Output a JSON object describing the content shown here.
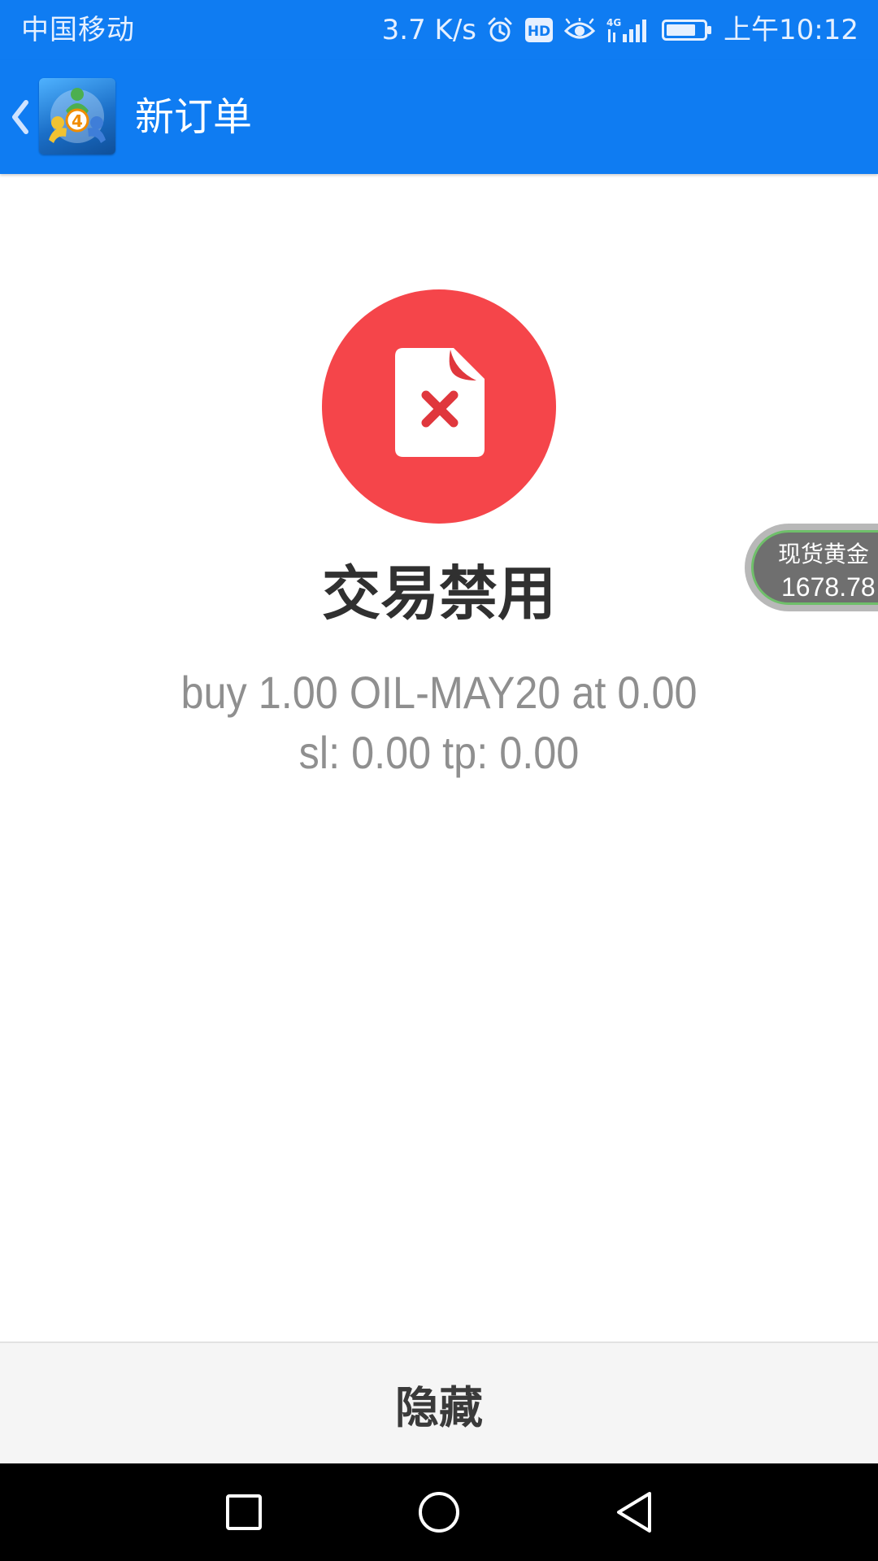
{
  "status_bar": {
    "carrier": "中国移动",
    "network_speed": "3.7 K/s",
    "hd_badge": "HD",
    "signal_type": "4G",
    "time": "上午10:12",
    "icons": [
      "alarm-icon",
      "hd-icon",
      "eye-icon",
      "signal-icon",
      "battery-icon"
    ]
  },
  "app_bar": {
    "title": "新订单",
    "logo_badge": "4",
    "icons": [
      "back-chevron-icon",
      "metatrader-logo"
    ]
  },
  "result": {
    "icon": "document-error-icon",
    "headline": "交易禁用",
    "order_line_1": "buy 1.00 OIL-MAY20 at 0.00",
    "order_line_2": "sl: 0.00 tp: 0.00"
  },
  "ticker": {
    "name": "现货黄金",
    "price": "1678.78"
  },
  "actions": {
    "hide_label": "隐藏"
  },
  "nav_bar": {
    "icons": [
      "recent-apps-icon",
      "home-icon",
      "back-icon"
    ]
  },
  "colors": {
    "app_bar": "#0f7cf2",
    "error_circle": "#f5454a",
    "error_mark": "#e0373d",
    "headline": "#303030",
    "order_text": "#8f8f8f",
    "ticker_border": "#6fbf6a"
  }
}
